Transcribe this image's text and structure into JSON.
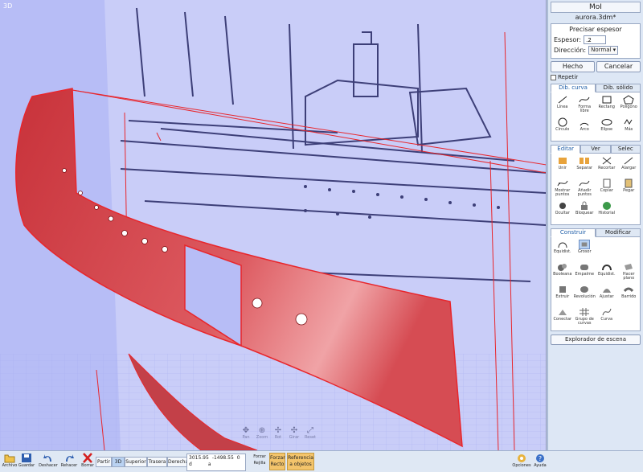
{
  "viewport": {
    "label": "3D"
  },
  "view_controls": [
    "Pan",
    "Zoom",
    "Rot",
    "Girar",
    "Reset"
  ],
  "panel": {
    "app_title": "MoI",
    "window_buttons": "_ ❐ ✕",
    "file_name": "aurora.3dm*",
    "command": {
      "title": "Precisar espesor",
      "thickness_label": "Espesor:",
      "thickness_value": ".2",
      "direction_label": "Dirección:",
      "direction_value": "Normal",
      "done_label": "Hecho",
      "cancel_label": "Cancelar",
      "repeat_label": "Repetir"
    },
    "draw_tabs": [
      {
        "label": "Dib. curva",
        "active": true
      },
      {
        "label": "Dib. sólido",
        "active": false
      }
    ],
    "draw_tools": [
      "Línea",
      "Forma libre",
      "Rectang",
      "Polígono",
      "Círculo",
      "Arco",
      "Elipse",
      "Más"
    ],
    "edit_tabs": [
      {
        "label": "Editar",
        "active": true
      },
      {
        "label": "Ver",
        "active": false
      },
      {
        "label": "Selec",
        "active": false
      }
    ],
    "edit_tools": [
      "Unir",
      "Separar",
      "Recortar",
      "Alargar",
      "Mostrar puntos",
      "Añadir puntos",
      "Copiar",
      "Pegar",
      "Ocultar",
      "Bloquear",
      "Historial"
    ],
    "build_tabs": [
      {
        "label": "Construir",
        "active": true
      },
      {
        "label": "Modificar",
        "active": false
      }
    ],
    "build_tools_top": [
      "Equidist.",
      "Grosor"
    ],
    "build_tools": [
      "Booleana",
      "Empalme",
      "Equidist.",
      "Hacer plano",
      "Extruir",
      "Revolución",
      "Ajustar",
      "Barrido",
      "Conectar",
      "Grupo de curvas",
      "Curva"
    ],
    "scene_explorer_label": "Explorador de escena"
  },
  "toolbar": {
    "archivo": "Archivo",
    "guardar": "Guardar",
    "deshacer": "Deshacer",
    "rehacer": "Rehacer",
    "borrar": "Borrar",
    "views": [
      {
        "label": "Partir",
        "active": false
      },
      {
        "label": "3D",
        "active": true
      },
      {
        "label": "Superior",
        "active": false
      },
      {
        "label": "Trasera",
        "active": false
      },
      {
        "label": "Derecha",
        "active": false
      }
    ],
    "coord_x": "3015.95",
    "coord_y": "-1498.55",
    "coord_z": "0",
    "coord_d": "d",
    "coord_a": "a",
    "forzar_rejilla": "Forzar Rejilla",
    "forzar_recto": "Forzar Recto",
    "referencia_objetos": "Referencia a objetos",
    "opciones": "Opciones",
    "ayuda": "Ayuda"
  },
  "colors": {
    "viewport_bg": "#b7bdf6",
    "selection_red": "#e8262c",
    "hull_fill": "#d9474e",
    "blueprint_line": "#3d3f78",
    "active_button": "#f3c46b"
  }
}
